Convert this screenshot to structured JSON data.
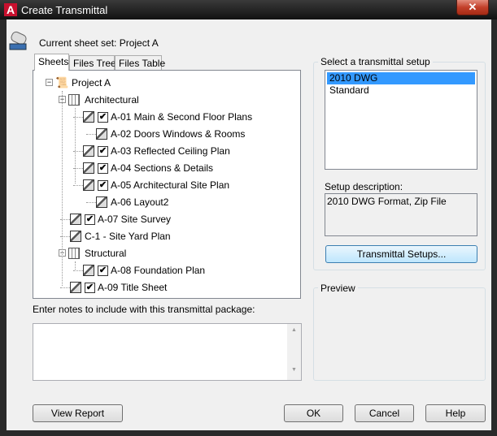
{
  "window": {
    "title": "Create Transmittal",
    "close": "✕",
    "app_icon": "A"
  },
  "current_sheet_set": "Current sheet set: Project A",
  "tabs": [
    "Sheets",
    "Files Tree",
    "Files Table"
  ],
  "tree": {
    "root": "Project A",
    "architectural": "Architectural",
    "structural": "Structural",
    "sheets": [
      {
        "label": "A-01 Main & Second Floor Plans",
        "checked": true
      },
      {
        "label": "A-02 Doors Windows & Rooms",
        "checked": false
      },
      {
        "label": "A-03 Reflected Ceiling Plan",
        "checked": true
      },
      {
        "label": "A-04 Sections & Details",
        "checked": true
      },
      {
        "label": "A-05 Architectural Site Plan",
        "checked": true
      },
      {
        "label": "A-06 Layout2",
        "checked": false
      },
      {
        "label": "A-07 Site Survey",
        "checked": true
      },
      {
        "label": "C-1 - Site Yard Plan",
        "checked": false
      },
      {
        "label": "A-08 Foundation Plan",
        "checked": true
      },
      {
        "label": "A-09 Title Sheet",
        "checked": true
      }
    ]
  },
  "notes_label": "Enter notes to include with this transmittal package:",
  "notes_value": "",
  "setup": {
    "group_label": "Select a transmittal setup",
    "options": [
      "2010 DWG",
      "Standard"
    ],
    "selected": "2010 DWG",
    "description_label": "Setup description:",
    "description": "2010 DWG Format, Zip File",
    "setups_button": "Transmittal Setups..."
  },
  "preview_label": "Preview",
  "buttons": {
    "view_report": "View Report",
    "ok": "OK",
    "cancel": "Cancel",
    "help": "Help"
  }
}
